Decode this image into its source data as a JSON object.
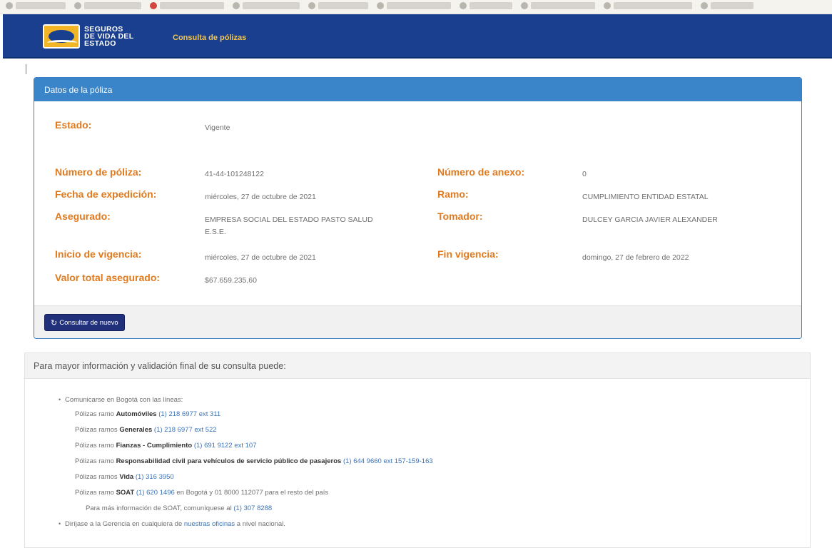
{
  "brand": {
    "line1": "SEGUROS",
    "line2": "DE VIDA DEL",
    "line3": "ESTADO"
  },
  "nav": {
    "link_label": "Consulta de pólizas"
  },
  "policy_panel": {
    "title": "Datos de la póliza",
    "estado_label": "Estado:",
    "estado_value": "Vigente",
    "numero_poliza_label": "Número de póliza:",
    "numero_poliza_value": "41-44-101248122",
    "numero_anexo_label": "Número de anexo:",
    "numero_anexo_value": "0",
    "fecha_expedicion_label": "Fecha de expedición:",
    "fecha_expedicion_value": "miércoles, 27 de octubre de 2021",
    "ramo_label": "Ramo:",
    "ramo_value": "CUMPLIMIENTO ENTIDAD ESTATAL",
    "asegurado_label": "Asegurado:",
    "asegurado_value": "EMPRESA SOCIAL DEL ESTADO PASTO SALUD E.S.E.",
    "tomador_label": "Tomador:",
    "tomador_value": "DULCEY GARCIA JAVIER ALEXANDER",
    "inicio_vigencia_label": "Inicio de vigencia:",
    "inicio_vigencia_value": "miércoles, 27 de octubre de 2021",
    "fin_vigencia_label": "Fin vigencia:",
    "fin_vigencia_value": "domingo, 27 de febrero de 2022",
    "valor_total_label": "Valor total asegurado:",
    "valor_total_value": "$67.659.235,60",
    "consult_again_button": "Consultar de nuevo"
  },
  "info_panel": {
    "title": "Para mayor información y validación final de su consulta puede:",
    "item1_text": "Comunicarse en Bogotá con las líneas:",
    "autos_prefix": "Pólizas ramo ",
    "autos_bold": "Automóviles",
    "autos_phone": "(1) 218 6977 ext 311",
    "generales_prefix": "Pólizas ramos ",
    "generales_bold": "Generales",
    "generales_phone": "(1) 218 6977 ext 522",
    "fianzas_prefix": "Pólizas ramo ",
    "fianzas_bold": "Fianzas - Cumplimiento",
    "fianzas_phone": "(1) 691 9122 ext 107",
    "rc_prefix": "Pólizas ramo ",
    "rc_bold": "Responsabilidad civil para vehículos de servicio público de pasajeros",
    "rc_phone": "(1) 644 9660 ext 157-159-163",
    "vida_prefix": "Pólizas ramos ",
    "vida_bold": "Vida",
    "vida_phone": "(1) 316 3950",
    "soat_prefix": "Pólizas ramo ",
    "soat_bold": "SOAT",
    "soat_phone": "(1) 620 1496",
    "soat_suffix": " en Bogotá y 01 8000 112077 para el resto del país",
    "soat_more_text": "Para más información de SOAT, comuníquese al ",
    "soat_more_phone": "(1) 307 8288",
    "item2_text": "Diríjase a la Gerencia en cualquiera de ",
    "item2_link": "nuestras oficinas",
    "item2_suffix": " a nivel nacional."
  }
}
